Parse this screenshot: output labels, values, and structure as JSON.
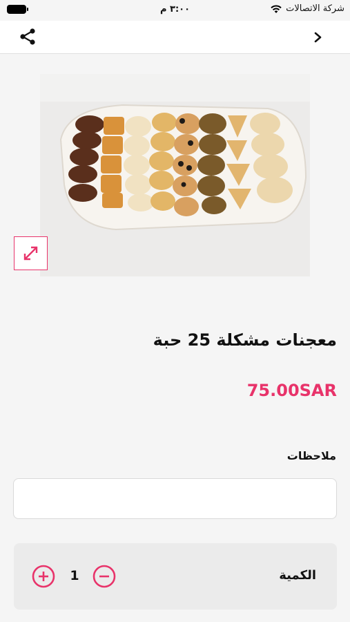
{
  "status_bar": {
    "carrier": "شركة الاتصالات",
    "time": "٣:٠٠ م"
  },
  "nav": {
    "back_icon": "chevron-right-icon",
    "share_icon": "share-icon"
  },
  "product": {
    "image_description": "tray of assorted pastries",
    "name": "معجنات مشكلة  25 حبة",
    "price": "75.00SAR"
  },
  "notes": {
    "label": "ملاحظات",
    "value": "",
    "placeholder": ""
  },
  "quantity": {
    "label": "الكمية",
    "value": "1"
  },
  "colors": {
    "accent": "#e8336a",
    "background": "#f5f5f5"
  }
}
